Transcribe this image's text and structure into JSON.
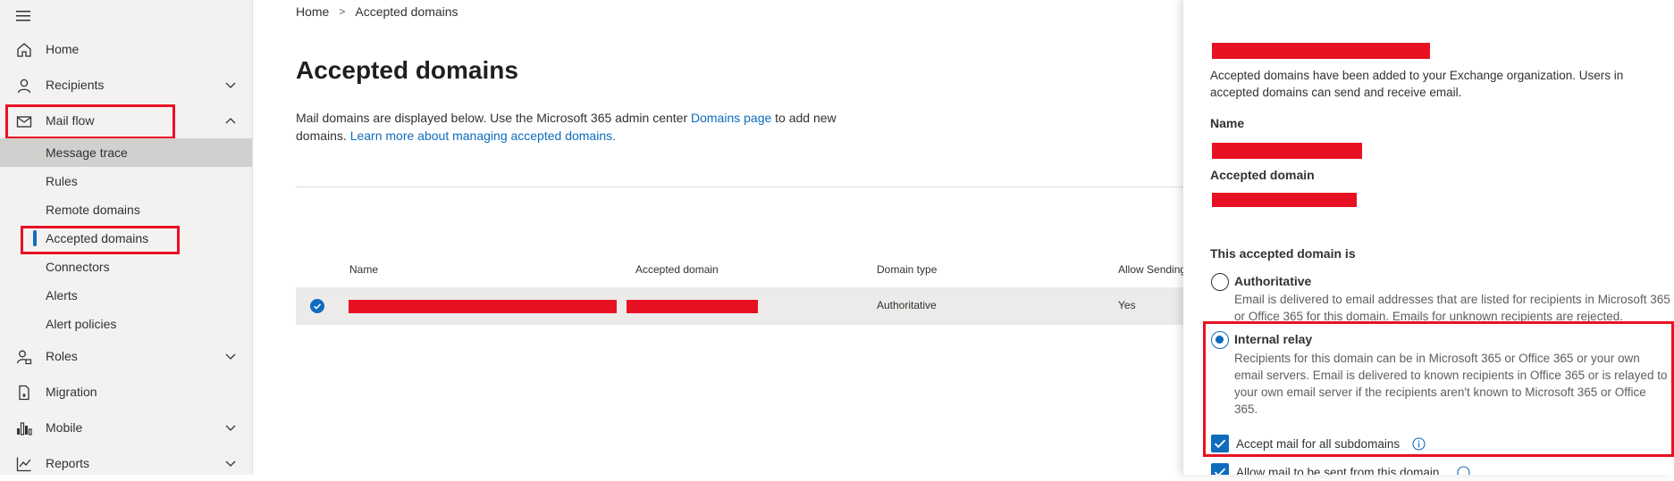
{
  "sidebar": {
    "menu_icon": "hamburger-icon",
    "items": [
      {
        "label": "Home",
        "icon": "home-icon"
      },
      {
        "label": "Recipients",
        "icon": "person-icon"
      },
      {
        "label": "Mail flow",
        "icon": "mail-icon"
      },
      {
        "label": "Roles",
        "icon": "roles-icon"
      },
      {
        "label": "Migration",
        "icon": "migration-icon"
      },
      {
        "label": "Mobile",
        "icon": "mobile-icon"
      },
      {
        "label": "Reports",
        "icon": "reports-icon"
      }
    ],
    "mail_flow_sub": [
      {
        "label": "Message trace"
      },
      {
        "label": "Rules"
      },
      {
        "label": "Remote domains"
      },
      {
        "label": "Accepted domains"
      },
      {
        "label": "Connectors"
      },
      {
        "label": "Alerts"
      },
      {
        "label": "Alert policies"
      }
    ]
  },
  "breadcrumb": {
    "home": "Home",
    "separator": ">",
    "current": "Accepted domains"
  },
  "page": {
    "title": "Accepted domains",
    "desc_part1": "Mail domains are displayed below. Use the Microsoft 365 admin center ",
    "desc_link1": "Domains page",
    "desc_part2": " to add new domains. ",
    "desc_link2": "Learn more about managing accepted domains."
  },
  "table": {
    "headers": [
      "Name",
      "Accepted domain",
      "Domain type",
      "Allow Sending"
    ],
    "rows": [
      {
        "name": "",
        "accepted_domain": "",
        "domain_type": "Authoritative",
        "allow_sending": "Yes"
      }
    ]
  },
  "panel": {
    "intro": "Accepted domains have been added to your Exchange organization. Users in accepted domains can send and receive email.",
    "name_label": "Name",
    "accepted_domain_label": "Accepted domain",
    "type_heading": "This accepted domain is",
    "authoritative_label": "Authoritative",
    "authoritative_desc": "Email is delivered to email addresses that are listed for recipients in Microsoft 365 or Office 365 for this domain. Emails for unknown recipients are rejected.",
    "internal_relay_label": "Internal relay",
    "internal_relay_desc": "Recipients for this domain can be in Microsoft 365 or Office 365 or your own email servers. Email is delivered to known recipients in Office 365 or is relayed to your own email server if the recipients aren't known to Microsoft 365 or Office 365.",
    "accept_subdomains_label": "Accept mail for all subdomains",
    "allow_send_label": "Allow mail to be sent from this domain",
    "selected_type": "Internal relay"
  },
  "colors": {
    "accent": "#0f6cbd",
    "highlight": "#e81123",
    "sidebar_bg": "#f3f2f1"
  }
}
